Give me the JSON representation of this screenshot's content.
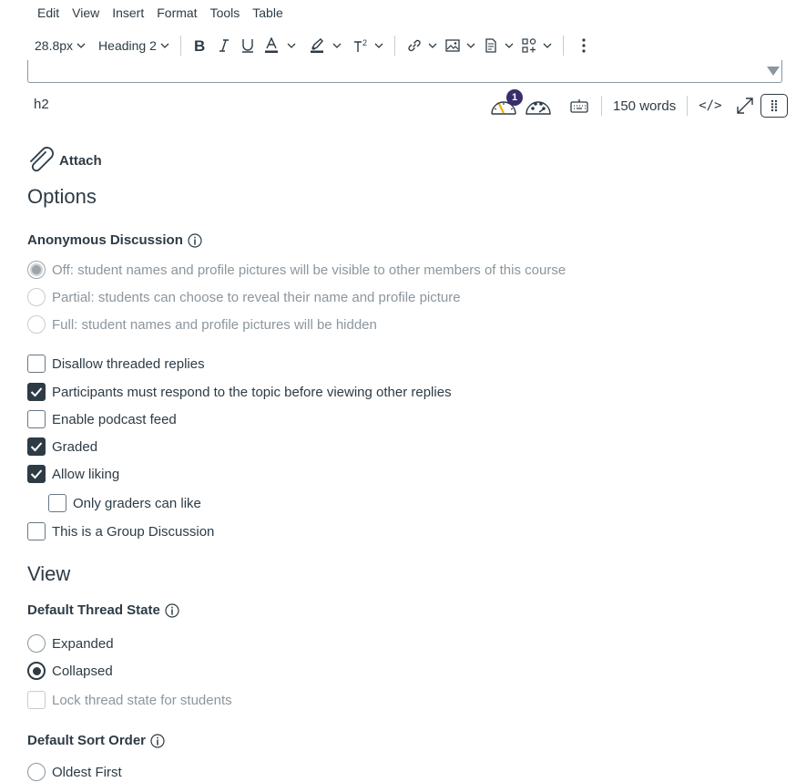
{
  "menubar": {
    "items": [
      "Edit",
      "View",
      "Insert",
      "Format",
      "Tools",
      "Table"
    ]
  },
  "toolbar": {
    "font_size": "28.8px",
    "block_format": "Heading 2",
    "icons": [
      "bold-icon",
      "italic-icon",
      "underline-icon",
      "text-color-icon",
      "highlight-icon",
      "superscript-icon",
      "link-icon",
      "image-icon",
      "document-icon",
      "apps-icon",
      "more-icon"
    ]
  },
  "statusbar": {
    "path": "h2",
    "badge_count": "1",
    "word_count": "150 words",
    "html_toggle": "</>"
  },
  "attach": {
    "label": "Attach"
  },
  "options": {
    "title": "Options",
    "anonymous": {
      "label": "Anonymous Discussion",
      "choices": [
        "Off: student names and profile pictures will be visible to other members of this course",
        "Partial: students can choose to reveal their name and profile picture",
        "Full: student names and profile pictures will be hidden"
      ]
    },
    "checkboxes": [
      {
        "label": "Disallow threaded replies",
        "checked": false
      },
      {
        "label": "Participants must respond to the topic before viewing other replies",
        "checked": true
      },
      {
        "label": "Enable podcast feed",
        "checked": false
      },
      {
        "label": "Graded",
        "checked": true
      },
      {
        "label": "Allow liking",
        "checked": true
      },
      {
        "label": "Only graders can like",
        "checked": false
      },
      {
        "label": "This is a Group Discussion",
        "checked": false
      }
    ]
  },
  "view": {
    "title": "View",
    "thread_state": {
      "label": "Default Thread State",
      "choices": [
        "Expanded",
        "Collapsed"
      ],
      "lock_label": "Lock thread state for students"
    },
    "sort_order": {
      "label": "Default Sort Order",
      "first_choice": "Oldest First"
    }
  },
  "colors": {
    "text": "#2d3b45",
    "muted": "#8b969e",
    "badge": "#3a2d6b",
    "border": "#8b969e"
  }
}
